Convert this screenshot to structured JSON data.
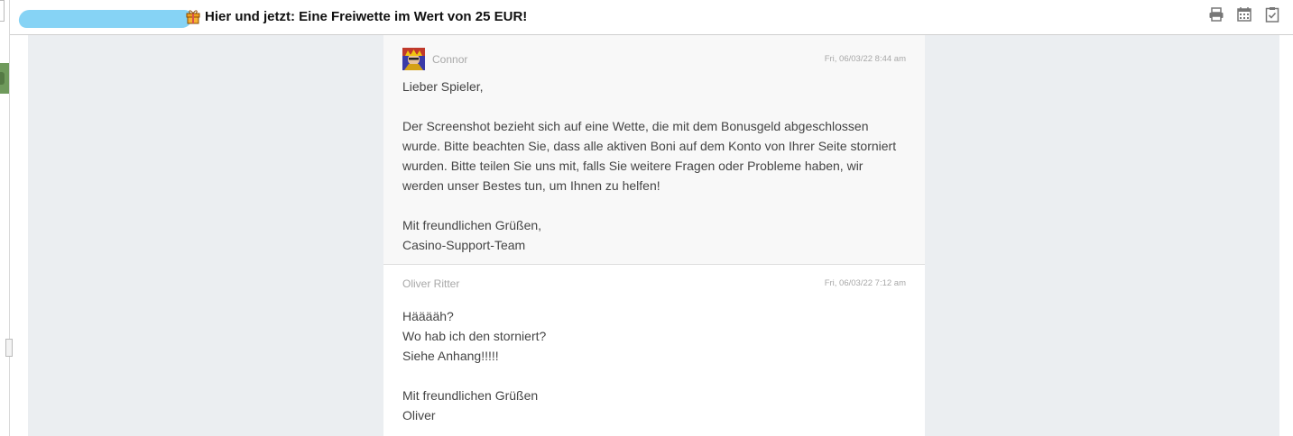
{
  "header": {
    "subject": "Hier und jetzt: Eine Freiwette im Wert von 25 EUR!",
    "gift_icon": "gift-icon",
    "toolbar": [
      {
        "name": "print-icon"
      },
      {
        "name": "calendar-icon"
      },
      {
        "name": "clipboard-check-icon"
      }
    ]
  },
  "messages": [
    {
      "author": "Connor",
      "date": "Fri, 06/03/22 8:44 am",
      "avatar": "avatar",
      "greeting": "Lieber Spieler,",
      "body_lines": [
        "Der Screenshot bezieht sich auf eine Wette, die mit dem Bonusgeld abgeschlossen",
        "wurde. Bitte beachten Sie, dass alle aktiven Boni auf dem Konto von Ihrer Seite storniert",
        "wurden. Bitte teilen Sie uns mit, falls Sie weitere Fragen oder Probleme haben, wir",
        "werden unser Bestes tun, um Ihnen zu helfen!"
      ],
      "closing": "Mit freundlichen Grüßen,",
      "signature": "Casino-Support-Team"
    },
    {
      "author": "Oliver Ritter",
      "date": "Fri, 06/03/22 7:12 am",
      "body_lines": [
        "Hääääh?",
        "Wo hab ich den storniert?",
        "Siehe Anhang!!!!!"
      ],
      "closing": "Mit freundlichen Grüßen",
      "signature": "Oliver"
    }
  ],
  "colors": {
    "redaction": "#86d3f5",
    "backdrop": "#ebeef1",
    "accent_green": "#6f9a5c"
  }
}
